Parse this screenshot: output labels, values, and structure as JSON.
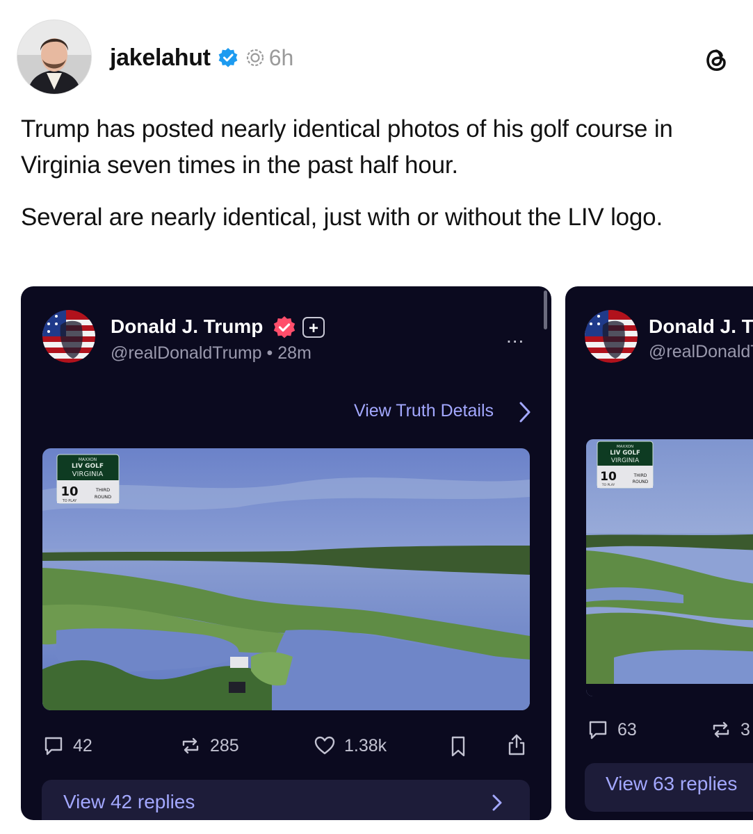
{
  "post": {
    "username": "jakelahut",
    "time": "6h",
    "paragraphs": [
      "Trump has posted nearly identical photos of his golf course in Virginia seven times in the past half hour.",
      "Several are nearly identical, just with or without the LIV logo."
    ]
  },
  "cards": [
    {
      "display_name": "Donald J. Trump",
      "handle": "@realDonaldTrump",
      "separator": "•",
      "time": "28m",
      "more": "...",
      "view_details": "View Truth Details",
      "scoreboard": {
        "brand": "MAXXON",
        "league": "LIV GOLF",
        "event": "VIRGINIA",
        "hole": "10",
        "to_play": "TO PLAY",
        "round_line1": "THIRD",
        "round_line2": "ROUND"
      },
      "replies": "42",
      "reposts": "285",
      "likes": "1.38k",
      "view_replies": "View 42 replies"
    },
    {
      "display_name": "Donald J. Tr",
      "handle": "@realDonaldT",
      "scoreboard": {
        "brand": "MAXXON",
        "league": "LIV GOLF",
        "event": "VIRGINIA",
        "hole": "10",
        "to_play": "TO PLAY",
        "round_line1": "THIRD",
        "round_line2": "ROUND"
      },
      "replies": "63",
      "reposts": "3",
      "view_replies": "View 63 replies"
    }
  ],
  "icons": {
    "verified": "verified-badge-icon",
    "ai_label": "ai-label-icon",
    "threads": "threads-logo-icon",
    "reply": "comment-bubble-icon",
    "repost": "repost-icon",
    "like": "heart-icon",
    "bookmark": "bookmark-icon",
    "share": "share-icon"
  },
  "colors": {
    "card_bg": "#0b0a1f",
    "link": "#a3a8ff",
    "verified_blue": "#1d9bf0",
    "truth_badge": "#ff4e6b"
  }
}
